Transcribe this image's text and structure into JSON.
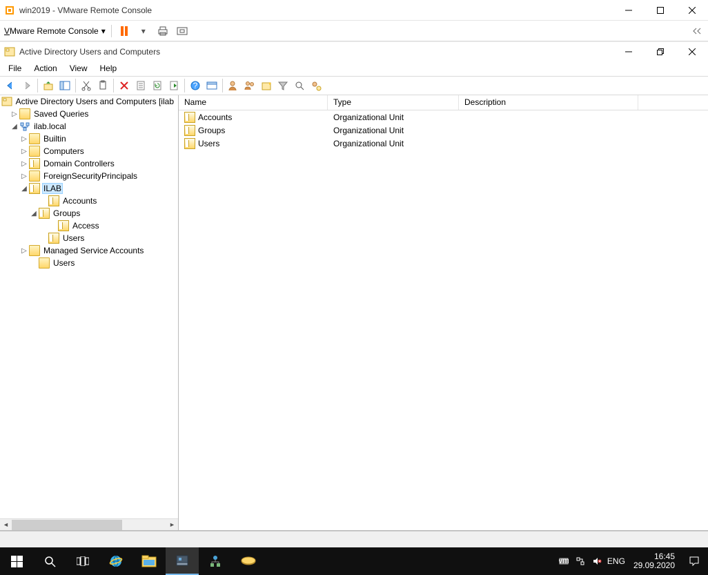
{
  "vmware": {
    "title": "win2019 - VMware Remote Console",
    "menu_label": "Mware Remote Console",
    "menu_prefix": "V"
  },
  "ad": {
    "title": "Active Directory Users and Computers",
    "menu": [
      "File",
      "Action",
      "View",
      "Help"
    ]
  },
  "tree": {
    "root": "Active Directory Users and Computers [ilab",
    "saved_queries": "Saved Queries",
    "domain": "ilab.local",
    "nodes": {
      "builtin": "Builtin",
      "computers": "Computers",
      "domain_controllers": "Domain Controllers",
      "fsp": "ForeignSecurityPrincipals",
      "ilab": "ILAB",
      "accounts": "Accounts",
      "groups": "Groups",
      "access": "Access",
      "users_ou": "Users",
      "msa": "Managed Service Accounts",
      "users": "Users"
    }
  },
  "list": {
    "columns": {
      "name": "Name",
      "type": "Type",
      "description": "Description"
    },
    "rows": [
      {
        "name": "Accounts",
        "type": "Organizational Unit",
        "description": ""
      },
      {
        "name": "Groups",
        "type": "Organizational Unit",
        "description": ""
      },
      {
        "name": "Users",
        "type": "Organizational Unit",
        "description": ""
      }
    ]
  },
  "taskbar": {
    "lang": "ENG",
    "time": "16:45",
    "date": "29.09.2020"
  }
}
